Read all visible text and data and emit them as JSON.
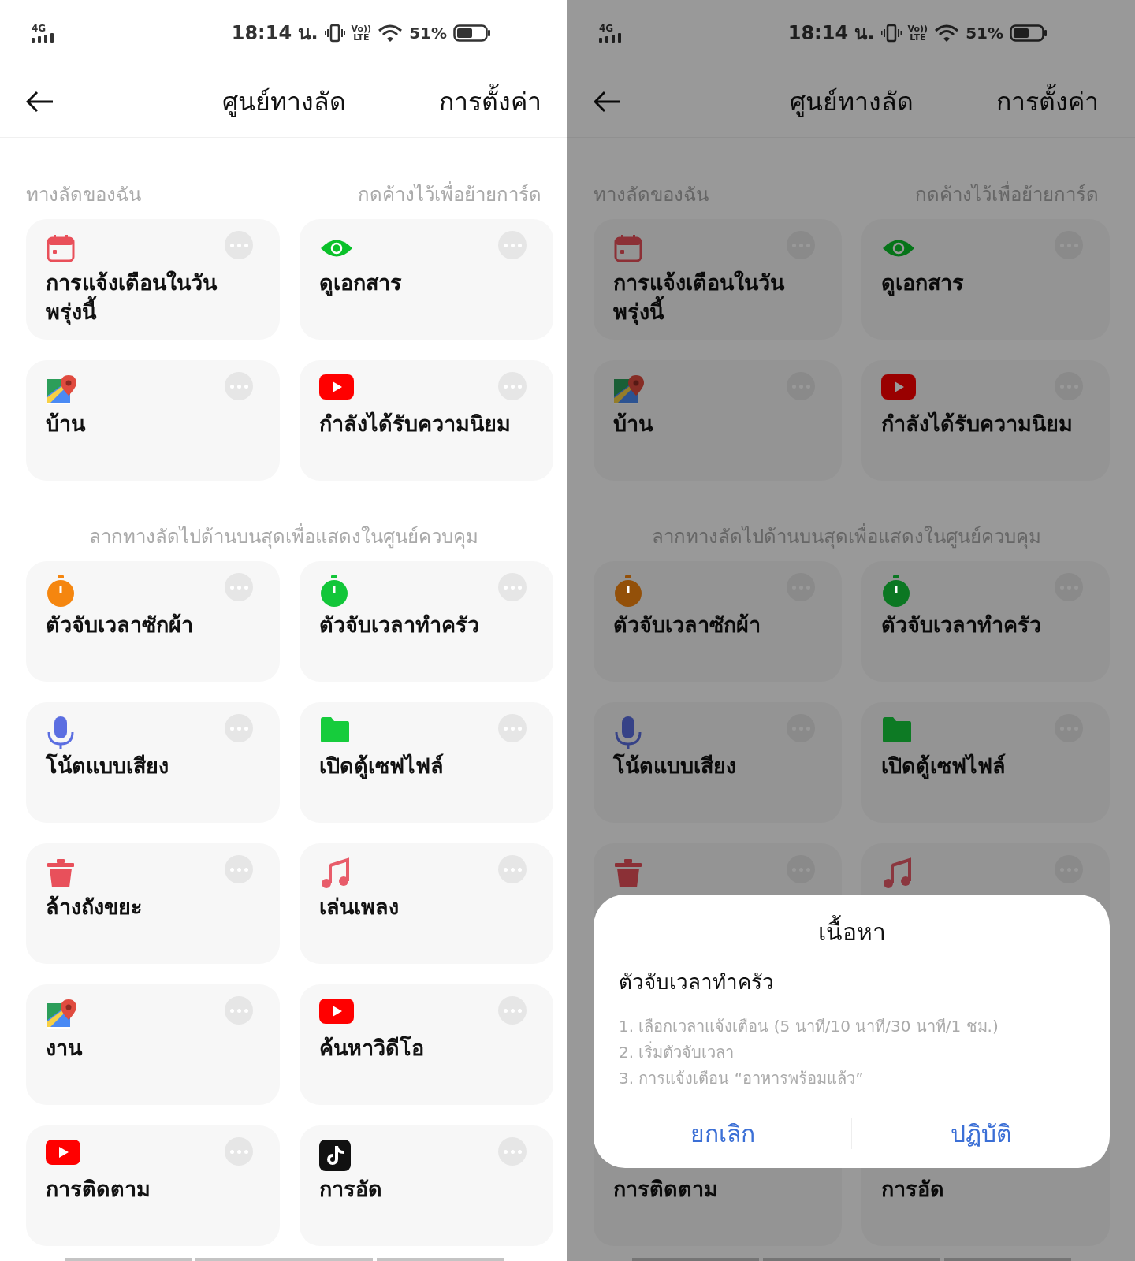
{
  "screens": [
    {
      "status_bar": {
        "network": "4G",
        "time": "18:14 น.",
        "volte": [
          "Vo))",
          "LTE"
        ],
        "battery_text": "51%"
      },
      "header": {
        "title": "ศูนย์ทางลัด",
        "action": "การตั้งค่า"
      },
      "sections": [
        {
          "title": "ทางลัดของฉัน",
          "hint": "กดค้างไว้เพื่อย้ายการ์ด",
          "cards": [
            {
              "kind": "calendar",
              "label": "การแจ้งเตือนในวันพรุ่งนี้"
            },
            {
              "kind": "eye",
              "label": "ดูเอกสาร"
            },
            {
              "kind": "map",
              "label": "บ้าน"
            },
            {
              "kind": "video",
              "label": "กำลังได้รับความนิยม"
            }
          ]
        },
        {
          "title": "ลากทางลัดไปด้านบนสุดเพื่อแสดงในศูนย์ควบคุม",
          "cards": [
            {
              "kind": "stopwatch",
              "color": "#f5860f",
              "label": "ตัวจับเวลาซักผ้า"
            },
            {
              "kind": "stopwatch",
              "color": "#12c639",
              "label": "ตัวจับเวลาทำครัว"
            },
            {
              "kind": "mic",
              "label": "โน้ตแบบเสียง"
            },
            {
              "kind": "folder",
              "label": "เปิดตู้เซฟไฟล์"
            },
            {
              "kind": "trash",
              "label": "ล้างถังขยะ"
            },
            {
              "kind": "music",
              "label": "เล่นเพลง"
            },
            {
              "kind": "map",
              "label": "งาน"
            },
            {
              "kind": "video",
              "label": "ค้นหาวิดีโอ"
            },
            {
              "kind": "video",
              "label": "การติดตาม"
            },
            {
              "kind": "note",
              "label": "การอัด"
            }
          ]
        }
      ]
    },
    {
      "status_bar": {
        "network": "4G",
        "time": "18:14 น.",
        "volte": [
          "Vo))",
          "LTE"
        ],
        "battery_text": "51%"
      },
      "header": {
        "title": "ศูนย์ทางลัด",
        "action": "การตั้งค่า"
      },
      "sections": [
        {
          "title": "ทางลัดของฉัน",
          "hint": "กดค้างไว้เพื่อย้ายการ์ด",
          "cards": [
            {
              "kind": "calendar",
              "label": "การแจ้งเตือนในวันพรุ่งนี้"
            },
            {
              "kind": "eye",
              "label": "ดูเอกสาร"
            },
            {
              "kind": "map",
              "label": "บ้าน"
            },
            {
              "kind": "video",
              "label": "กำลังได้รับความนิยม"
            }
          ]
        },
        {
          "title": "ลากทางลัดไปด้านบนสุดเพื่อแสดงในศูนย์ควบคุม",
          "cards": [
            {
              "kind": "stopwatch",
              "color": "#935009",
              "label": "ตัวจับเวลาซักผ้า"
            },
            {
              "kind": "stopwatch",
              "color": "#0b7722",
              "label": "ตัวจับเวลาทำครัว"
            },
            {
              "kind": "mic",
              "label": "โน้ตแบบเสียง"
            },
            {
              "kind": "folder",
              "label": "เปิดตู้เซฟไฟล์"
            },
            {
              "kind": "trash"
            },
            {
              "kind": "music"
            },
            {
              "kind": "covered"
            },
            {
              "kind": "covered"
            },
            {
              "kind": "covered",
              "label": "การติดตาม"
            },
            {
              "kind": "covered",
              "label": "การอัด"
            }
          ]
        }
      ],
      "dialog": {
        "title": "เนื้อหา",
        "subtitle": "ตัวจับเวลาทำครัว",
        "steps": [
          "1. เลือกเวลาแจ้งเตือน (5 นาที/10 นาที/30 นาที/1 ชม.)",
          "2. เริ่มตัวจับเวลา",
          "3. การแจ้งเตือน “อาหารพร้อมแล้ว”"
        ],
        "buttons": [
          "ยกเลิก",
          "ปฏิบัติ"
        ]
      }
    }
  ]
}
